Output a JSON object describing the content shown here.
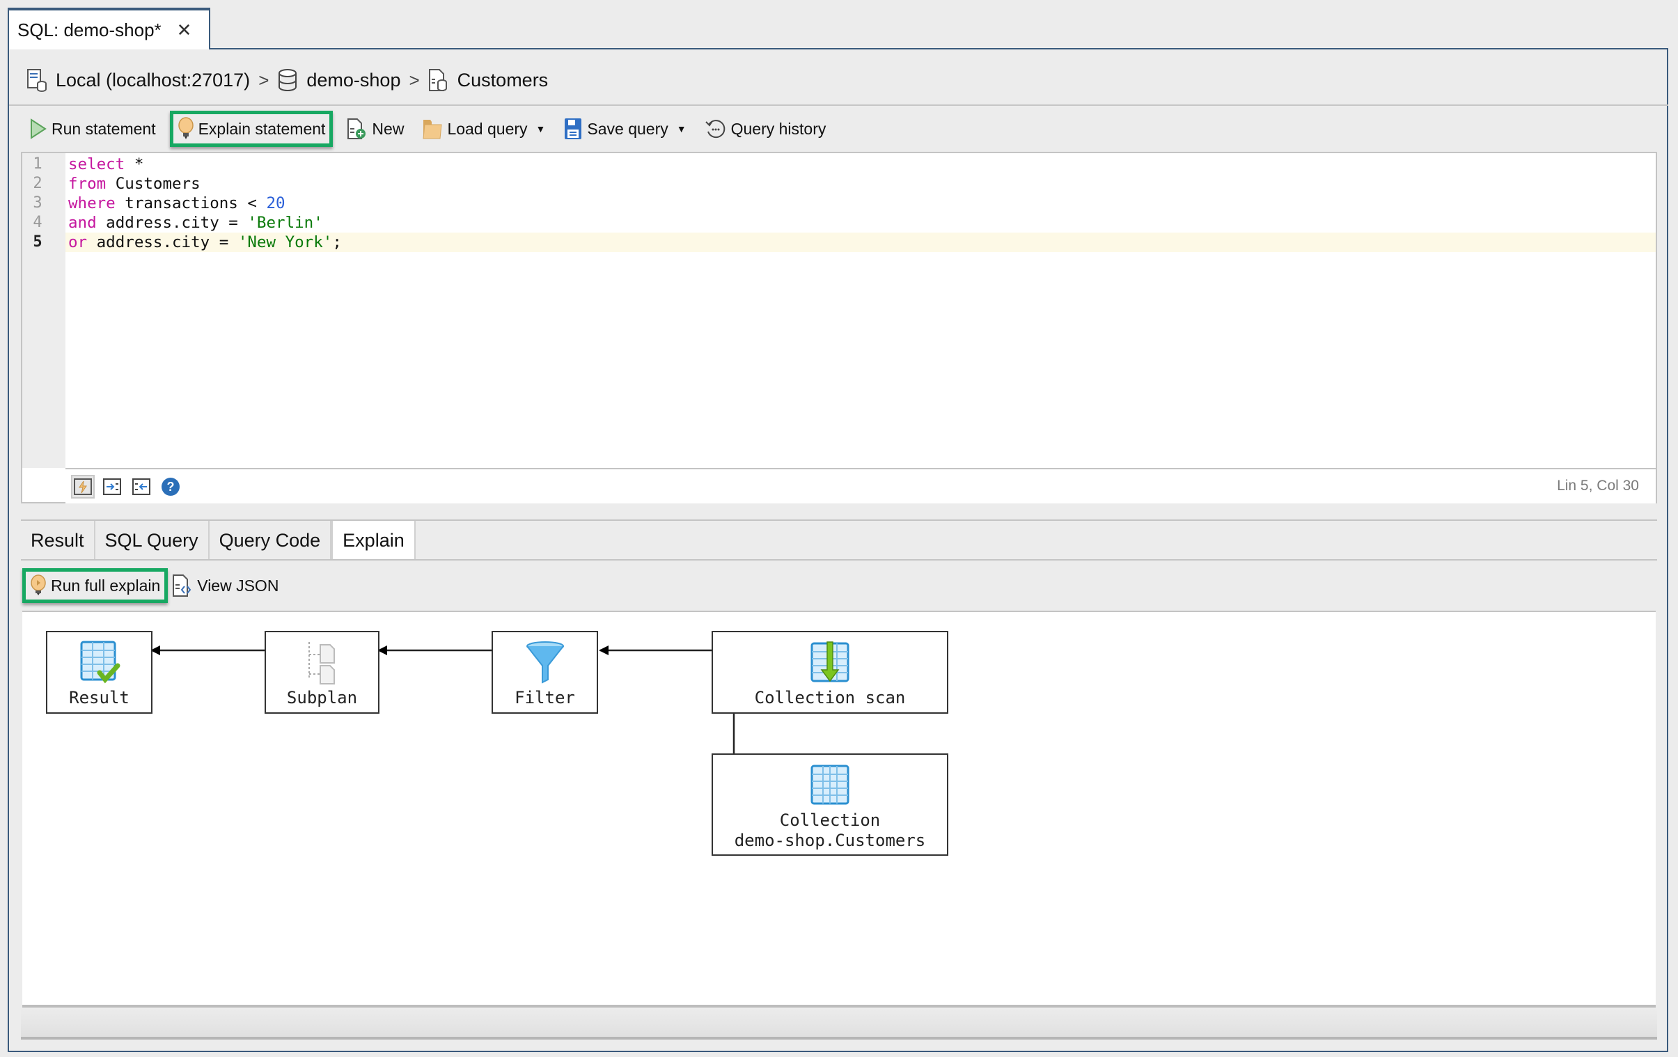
{
  "document_tab": {
    "title": "SQL: demo-shop*",
    "close_symbol": "✕"
  },
  "breadcrumb": {
    "items": [
      {
        "label": "Local (localhost:27017)",
        "icon": "server-icon"
      },
      {
        "label": "demo-shop",
        "icon": "database-icon"
      },
      {
        "label": "Customers",
        "icon": "collection-icon"
      }
    ],
    "separator": ">"
  },
  "toolbar": {
    "run_statement": "Run statement",
    "explain_statement": "Explain statement",
    "new": "New",
    "load_query": "Load query",
    "save_query": "Save query",
    "query_history": "Query history",
    "dropdown_symbol": "▼"
  },
  "editor": {
    "line_numbers": [
      "1",
      "2",
      "3",
      "4",
      "5"
    ],
    "active_line": 5,
    "lines": [
      [
        {
          "t": "select",
          "c": "kw"
        },
        {
          "t": " *",
          "c": ""
        }
      ],
      [
        {
          "t": "from",
          "c": "kw"
        },
        {
          "t": " Customers",
          "c": ""
        }
      ],
      [
        {
          "t": "where",
          "c": "kw"
        },
        {
          "t": " transactions < ",
          "c": ""
        },
        {
          "t": "20",
          "c": "num"
        }
      ],
      [
        {
          "t": "and",
          "c": "kw"
        },
        {
          "t": " address.city = ",
          "c": ""
        },
        {
          "t": "'Berlin'",
          "c": "str"
        }
      ],
      [
        {
          "t": "or",
          "c": "kw"
        },
        {
          "t": " address.city = ",
          "c": ""
        },
        {
          "t": "'New York'",
          "c": "str"
        },
        {
          "t": ";",
          "c": ""
        }
      ]
    ],
    "footer_icons": [
      "format-code-icon",
      "indent-icon",
      "outdent-icon",
      "help-icon"
    ],
    "help_symbol": "?",
    "status": "Lin 5, Col 30"
  },
  "result_tabs": {
    "tabs": [
      {
        "label": "Result",
        "active": false
      },
      {
        "label": "SQL Query",
        "active": false
      },
      {
        "label": "Query Code",
        "active": false
      },
      {
        "label": "Explain",
        "active": true
      }
    ]
  },
  "explain_toolbar": {
    "run_full_explain": "Run full explain",
    "view_json": "View JSON"
  },
  "explain_plan": {
    "nodes": [
      {
        "id": "result",
        "label": "Result",
        "icon": "result-table-icon"
      },
      {
        "id": "subplan",
        "label": "Subplan",
        "icon": "subplan-icon"
      },
      {
        "id": "filter",
        "label": "Filter",
        "icon": "filter-funnel-icon"
      },
      {
        "id": "collscan",
        "label": "Collection scan",
        "icon": "collection-scan-icon"
      },
      {
        "id": "collection",
        "label": "Collection",
        "sublabel": "demo-shop.Customers",
        "icon": "collection-table-icon"
      }
    ],
    "edges": [
      {
        "from": "subplan",
        "to": "result"
      },
      {
        "from": "filter",
        "to": "subplan"
      },
      {
        "from": "collscan",
        "to": "filter"
      },
      {
        "from": "collscan",
        "to": "collection"
      }
    ]
  },
  "colors": {
    "highlight_border": "#17a862",
    "frame_border": "#3a5a7c",
    "keyword": "#c5179f",
    "number": "#2a5fd8",
    "string": "#0a7a0a",
    "active_line_bg": "#fdf9e6"
  }
}
